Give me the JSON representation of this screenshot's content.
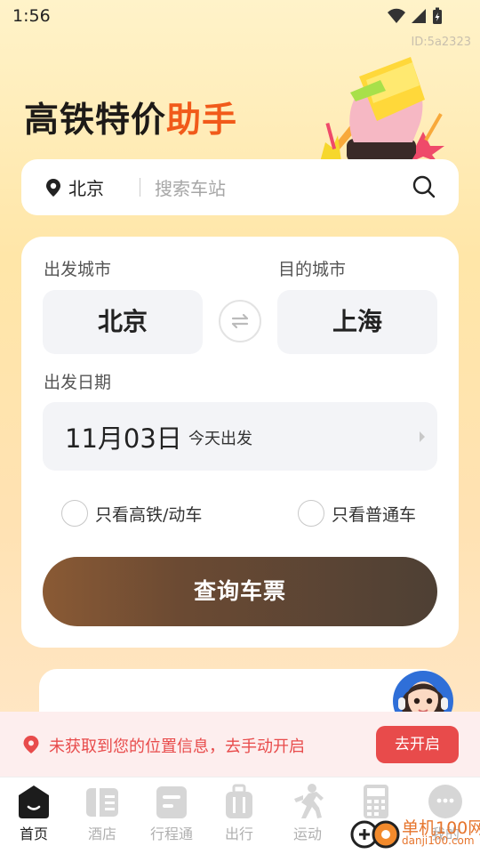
{
  "status_bar": {
    "time": "1:56"
  },
  "id_text": "ID:5a2323",
  "hero": {
    "title_part1": "高铁特价",
    "title_part2": "助手"
  },
  "search": {
    "city": "北京",
    "placeholder": "搜索车站"
  },
  "form": {
    "departure_label": "出发城市",
    "destination_label": "目的城市",
    "departure_city": "北京",
    "destination_city": "上海",
    "date_label": "出发日期",
    "date_value": "11月03日",
    "date_sub": "今天出发",
    "option_high_speed": "只看高铁/动车",
    "option_regular": "只看普通车",
    "query_button": "查询车票"
  },
  "location_banner": {
    "message": "未获取到您的位置信息，去手动开启",
    "button": "去开启"
  },
  "tabbar": {
    "items": [
      {
        "label": "首页",
        "icon": "home-icon",
        "active": true
      },
      {
        "label": "酒店",
        "icon": "hotel-icon",
        "active": false
      },
      {
        "label": "行程通",
        "icon": "itinerary-icon",
        "active": false
      },
      {
        "label": "出行",
        "icon": "luggage-icon",
        "active": false
      },
      {
        "label": "运动",
        "icon": "running-icon",
        "active": false
      },
      {
        "label": "计算",
        "icon": "calculator-icon",
        "active": false
      },
      {
        "label": "我的",
        "icon": "profile-icon",
        "active": false
      }
    ]
  },
  "watermark": {
    "line1": "单机100网",
    "line2": "danji100.com"
  },
  "colors": {
    "accent_orange": "#f15a1a",
    "button_brown": "#6b4a33",
    "alert_red": "#e84b4b",
    "card_grey": "#f3f4f7"
  }
}
